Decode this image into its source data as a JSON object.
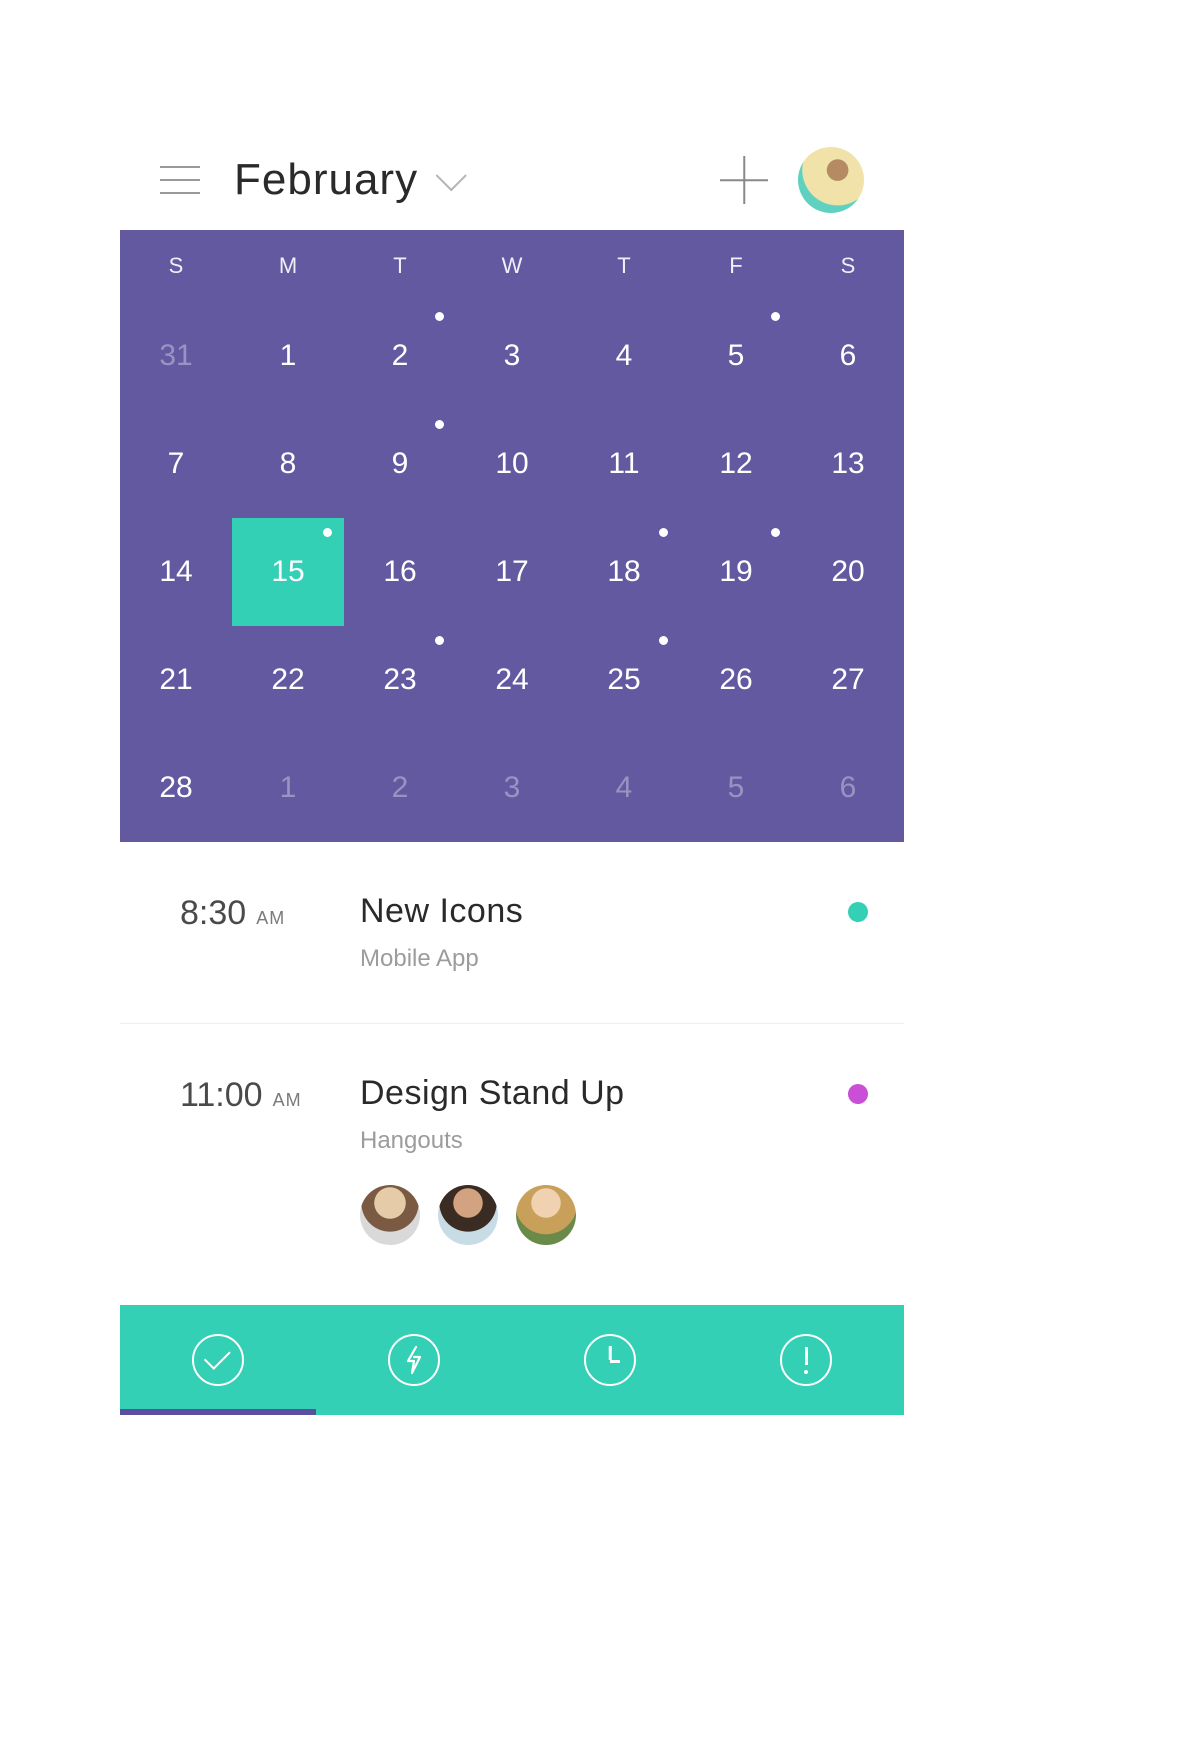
{
  "header": {
    "month_label": "February"
  },
  "calendar": {
    "weekdays": [
      "S",
      "M",
      "T",
      "W",
      "T",
      "F",
      "S"
    ],
    "weeks": [
      [
        {
          "d": "31",
          "muted": true,
          "dot": false,
          "selected": false
        },
        {
          "d": "1",
          "muted": false,
          "dot": false,
          "selected": false
        },
        {
          "d": "2",
          "muted": false,
          "dot": true,
          "selected": false
        },
        {
          "d": "3",
          "muted": false,
          "dot": false,
          "selected": false
        },
        {
          "d": "4",
          "muted": false,
          "dot": false,
          "selected": false
        },
        {
          "d": "5",
          "muted": false,
          "dot": true,
          "selected": false
        },
        {
          "d": "6",
          "muted": false,
          "dot": false,
          "selected": false
        }
      ],
      [
        {
          "d": "7",
          "muted": false,
          "dot": false,
          "selected": false
        },
        {
          "d": "8",
          "muted": false,
          "dot": false,
          "selected": false
        },
        {
          "d": "9",
          "muted": false,
          "dot": true,
          "selected": false
        },
        {
          "d": "10",
          "muted": false,
          "dot": false,
          "selected": false
        },
        {
          "d": "11",
          "muted": false,
          "dot": false,
          "selected": false
        },
        {
          "d": "12",
          "muted": false,
          "dot": false,
          "selected": false
        },
        {
          "d": "13",
          "muted": false,
          "dot": false,
          "selected": false
        }
      ],
      [
        {
          "d": "14",
          "muted": false,
          "dot": false,
          "selected": false
        },
        {
          "d": "15",
          "muted": false,
          "dot": true,
          "selected": true
        },
        {
          "d": "16",
          "muted": false,
          "dot": false,
          "selected": false
        },
        {
          "d": "17",
          "muted": false,
          "dot": false,
          "selected": false
        },
        {
          "d": "18",
          "muted": false,
          "dot": true,
          "selected": false
        },
        {
          "d": "19",
          "muted": false,
          "dot": true,
          "selected": false
        },
        {
          "d": "20",
          "muted": false,
          "dot": false,
          "selected": false
        }
      ],
      [
        {
          "d": "21",
          "muted": false,
          "dot": false,
          "selected": false
        },
        {
          "d": "22",
          "muted": false,
          "dot": false,
          "selected": false
        },
        {
          "d": "23",
          "muted": false,
          "dot": true,
          "selected": false
        },
        {
          "d": "24",
          "muted": false,
          "dot": false,
          "selected": false
        },
        {
          "d": "25",
          "muted": false,
          "dot": true,
          "selected": false
        },
        {
          "d": "26",
          "muted": false,
          "dot": false,
          "selected": false
        },
        {
          "d": "27",
          "muted": false,
          "dot": false,
          "selected": false
        }
      ],
      [
        {
          "d": "28",
          "muted": false,
          "dot": false,
          "selected": false
        },
        {
          "d": "1",
          "muted": true,
          "dot": false,
          "selected": false
        },
        {
          "d": "2",
          "muted": true,
          "dot": false,
          "selected": false
        },
        {
          "d": "3",
          "muted": true,
          "dot": false,
          "selected": false
        },
        {
          "d": "4",
          "muted": true,
          "dot": false,
          "selected": false
        },
        {
          "d": "5",
          "muted": true,
          "dot": false,
          "selected": false
        },
        {
          "d": "6",
          "muted": true,
          "dot": false,
          "selected": false
        }
      ]
    ]
  },
  "events": [
    {
      "time": "8:30",
      "ampm": "AM",
      "title": "New Icons",
      "subtitle": "Mobile App",
      "color": "#34d0b6",
      "attendees": 0
    },
    {
      "time": "11:00",
      "ampm": "AM",
      "title": "Design Stand Up",
      "subtitle": "Hangouts",
      "color": "#c94fd6",
      "attendees": 3
    }
  ],
  "tabs": {
    "items": [
      "check",
      "bolt",
      "clock",
      "alert"
    ],
    "active_index": 0
  },
  "colors": {
    "calendar_bg": "#6259a0",
    "accent": "#34d0b6",
    "tab_indicator": "#5a4fa0"
  }
}
